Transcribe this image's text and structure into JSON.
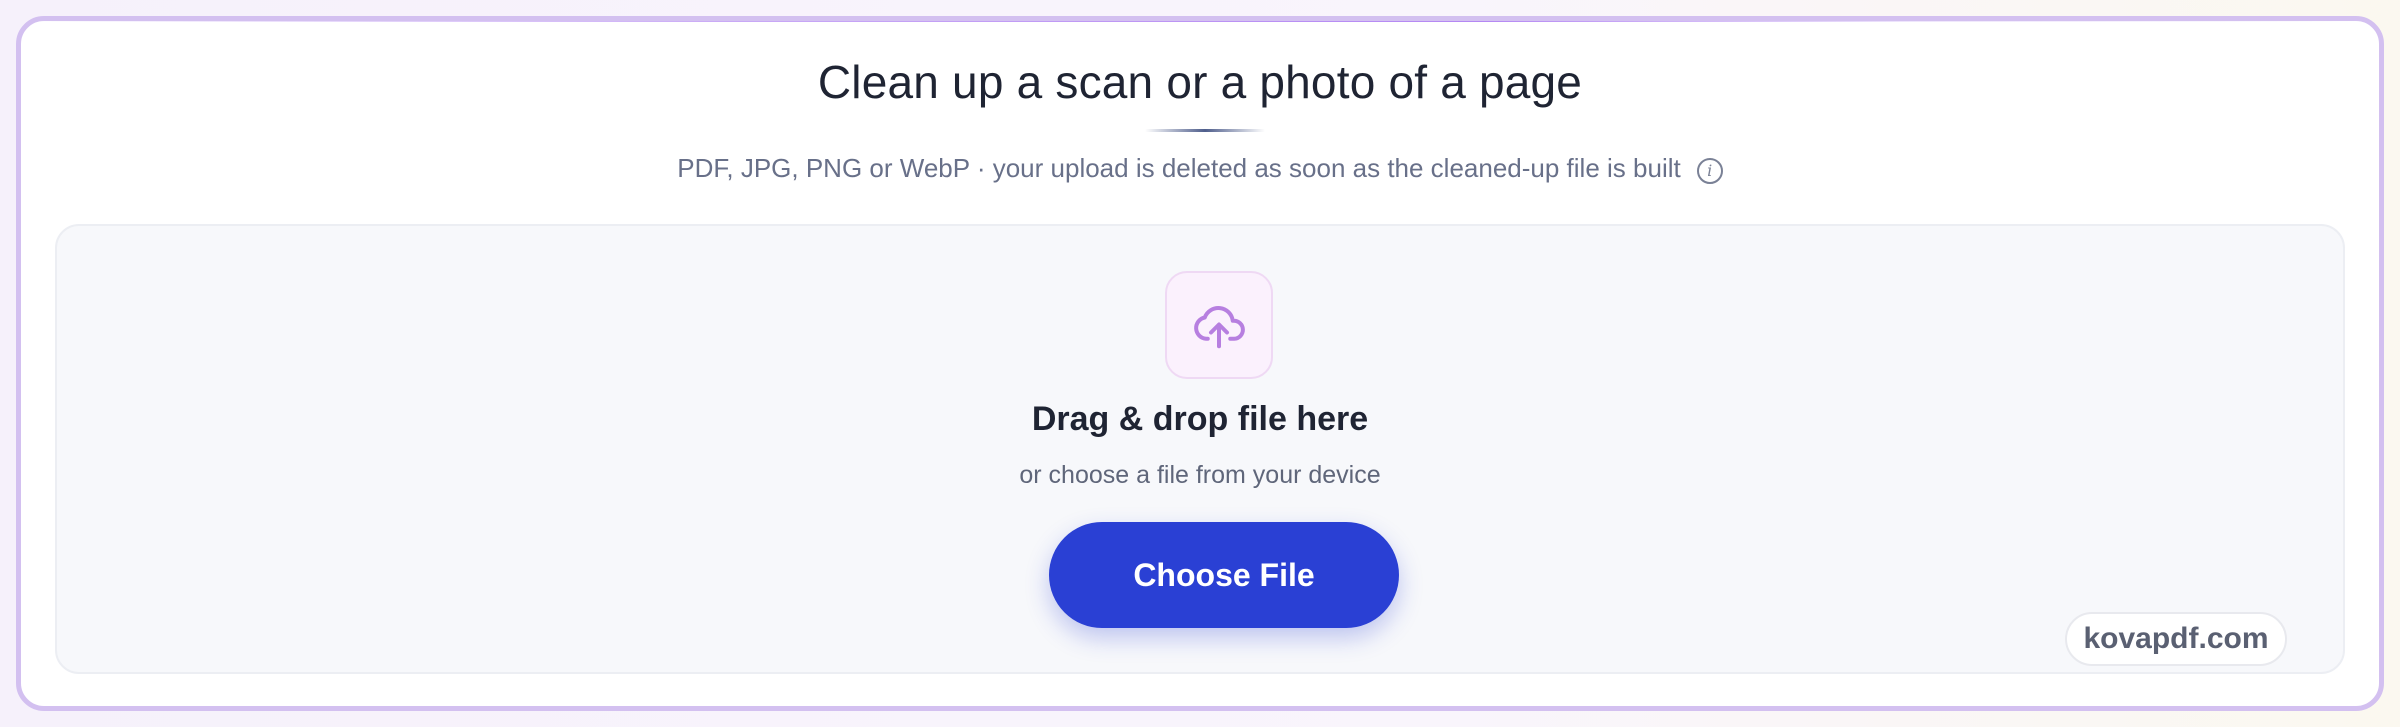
{
  "header": {
    "title": "Clean up a scan or a photo of a page",
    "subtitle": "PDF, JPG, PNG or WebP · your upload is deleted as soon as the cleaned-up file is built",
    "info_icon": "info-icon"
  },
  "dropzone": {
    "icon": "cloud-upload-icon",
    "heading": "Drag & drop file here",
    "subtext": "or choose a file from your device",
    "button_label": "Choose File"
  },
  "watermark": {
    "text": "kovapdf.com"
  },
  "colors": {
    "accent": "#2a40d4",
    "card_border": "#d3c0f0",
    "icon_purple": "#b77fe0"
  }
}
